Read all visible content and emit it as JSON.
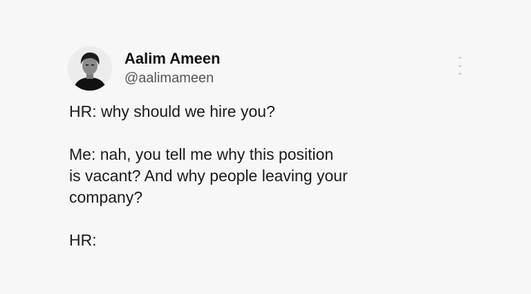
{
  "author": {
    "display_name": "Aalim Ameen",
    "handle": "@aalimameen"
  },
  "tweet": {
    "line_hr_question": "HR: why should we hire you?",
    "line_me_reply": "Me: nah, you tell me why this position\nis vacant? And why people leaving your\ncompany?",
    "line_hr_end": "HR:"
  },
  "icons": {
    "avatar": "profile-photo",
    "more": "more-vertical-icon"
  },
  "colors": {
    "background": "#f7f7f7",
    "text": "#1b1b1b",
    "handle": "#555555"
  }
}
